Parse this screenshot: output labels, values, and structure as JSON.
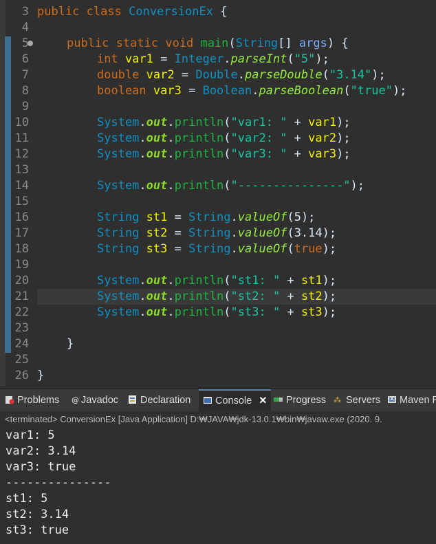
{
  "editor": {
    "line_numbers": [
      "3",
      "4",
      "5",
      "6",
      "7",
      "8",
      "9",
      "10",
      "11",
      "12",
      "13",
      "14",
      "15",
      "16",
      "17",
      "18",
      "19",
      "20",
      "21",
      "22",
      "23",
      "24",
      "25",
      "26"
    ],
    "lines": {
      "l3": {
        "kw1": "public",
        "kw2": "class",
        "name": "ConversionEx",
        "brace": " {"
      },
      "l5": {
        "kw1": "public",
        "kw2": "static",
        "kw3": "void",
        "mth": "main",
        "p1": "(",
        "cls": "String",
        "p2": "[] ",
        "prm": "args",
        "p3": ") {"
      },
      "l6": {
        "type": "int",
        "var": "var1",
        "eq": " = ",
        "cls": "Integer",
        "dot": ".",
        "mth": "parseInt",
        "p1": "(",
        "str": "\"5\"",
        "p2": ");"
      },
      "l7": {
        "type": "double",
        "var": "var2",
        "eq": " = ",
        "cls": "Double",
        "dot": ".",
        "mth": "parseDouble",
        "p1": "(",
        "str": "\"3.14\"",
        "p2": ");"
      },
      "l8": {
        "type": "boolean",
        "var": "var3",
        "eq": " = ",
        "cls": "Boolean",
        "dot": ".",
        "mth": "parseBoolean",
        "p1": "(",
        "str": "\"true\"",
        "p2": ");"
      },
      "l10": {
        "cls": "System",
        "dot": ".",
        "fld": "out",
        "dot2": ".",
        "mth": "println",
        "p1": "(",
        "str": "\"var1: \"",
        "plus": " + ",
        "var": "var1",
        "p2": ");"
      },
      "l11": {
        "cls": "System",
        "dot": ".",
        "fld": "out",
        "dot2": ".",
        "mth": "println",
        "p1": "(",
        "str": "\"var2: \"",
        "plus": " + ",
        "var": "var2",
        "p2": ");"
      },
      "l12": {
        "cls": "System",
        "dot": ".",
        "fld": "out",
        "dot2": ".",
        "mth": "println",
        "p1": "(",
        "str": "\"var3: \"",
        "plus": " + ",
        "var": "var3",
        "p2": ");"
      },
      "l14": {
        "cls": "System",
        "dot": ".",
        "fld": "out",
        "dot2": ".",
        "mth": "println",
        "p1": "(",
        "str": "\"---------------\"",
        "p2": ");"
      },
      "l16": {
        "cls": "String",
        "var": "st1",
        "eq": " = ",
        "cls2": "String",
        "dot": ".",
        "mth": "valueOf",
        "p1": "(",
        "arg": "5",
        "p2": ");"
      },
      "l17": {
        "cls": "String",
        "var": "st2",
        "eq": " = ",
        "cls2": "String",
        "dot": ".",
        "mth": "valueOf",
        "p1": "(",
        "arg": "3.14",
        "p2": ");"
      },
      "l18": {
        "cls": "String",
        "var": "st3",
        "eq": " = ",
        "cls2": "String",
        "dot": ".",
        "mth": "valueOf",
        "p1": "(",
        "arg": "true",
        "p2": ");"
      },
      "l20": {
        "cls": "System",
        "dot": ".",
        "fld": "out",
        "dot2": ".",
        "mth": "println",
        "p1": "(",
        "str": "\"st1: \"",
        "plus": " + ",
        "var": "st1",
        "p2": ");"
      },
      "l21": {
        "cls": "System",
        "dot": ".",
        "fld": "out",
        "dot2": ".",
        "mth": "println",
        "p1": "(",
        "str": "\"st2: \"",
        "plus": " + ",
        "var": "st2",
        "p2": ");"
      },
      "l22": {
        "cls": "System",
        "dot": ".",
        "fld": "out",
        "dot2": ".",
        "mth": "println",
        "p1": "(",
        "str": "\"st3: \"",
        "plus": " + ",
        "var": "st3",
        "p2": ");"
      },
      "l24": {
        "brace": "}"
      },
      "l26": {
        "brace": "}"
      }
    }
  },
  "tabs": {
    "problems": "Problems",
    "javadoc": "Javadoc",
    "declaration": "Declaration",
    "console": "Console",
    "console_close": "✕",
    "progress": "Progress",
    "servers": "Servers",
    "maven": "Maven R"
  },
  "console": {
    "header": "<terminated> ConversionEx [Java Application] D:₩JAVA₩jdk-13.0.1₩bin₩javaw.exe (2020. 9.",
    "output": [
      "var1: 5",
      "var2: 3.14",
      "var3: true",
      "---------------",
      "st1: 5",
      "st2: 3.14",
      "st3: true"
    ]
  },
  "colors": {
    "background": "#2f2f2f",
    "keyword": "#cc6c1d",
    "class": "#1290c3",
    "method": "#1eb540",
    "string": "#17c6a3",
    "field": "#8dda2a"
  }
}
